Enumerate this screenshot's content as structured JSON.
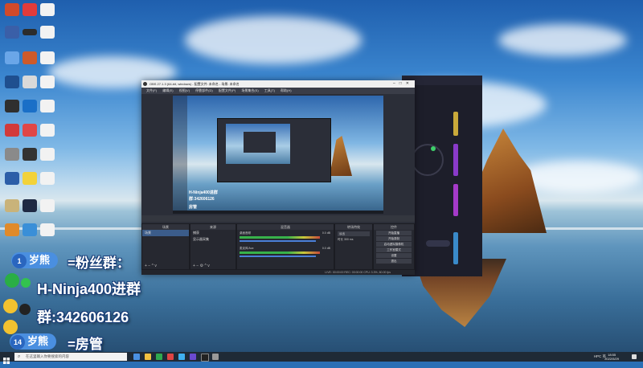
{
  "obs": {
    "title": "OBS 27.1.3 (64-bit, windows) - 配置文件: 未命名 - 场景: 未命名",
    "menu": [
      "文件(F)",
      "编辑(E)",
      "视图(V)",
      "停靠部件(D)",
      "配置文件(P)",
      "场景集合(S)",
      "工具(T)",
      "帮助(H)"
    ],
    "preview_labels": [
      "H-Ninja400进群",
      "群:342606126",
      "房管"
    ],
    "panels": {
      "scenes": "场景",
      "sources": "来源",
      "mixer": "混音器",
      "transitions": "转场特效",
      "controls": "控件"
    },
    "scenes_list": [
      "场景"
    ],
    "sources_list": [
      "捕获",
      "显示器采集"
    ],
    "mixer": {
      "tracks": [
        "桌面音频",
        "麦克风/Aux"
      ],
      "levels": [
        "0.0 dB",
        "0.0 dB"
      ]
    },
    "transition": {
      "type": "淡出",
      "duration_label": "时长",
      "duration": "300 ms"
    },
    "controls": [
      "开始直播",
      "开始录制",
      "启动虚拟摄像机",
      "工作室模式",
      "设置",
      "退出"
    ],
    "status": "LIVE: 00:00:00   REC: 00:00:00   CPU: 3.3%, 60.00 fps"
  },
  "overlay": {
    "badge1_level": "1",
    "badge1_name": "岁熊",
    "line1_suffix": "=粉丝群：",
    "line2": "H-Ninja400进群",
    "line3": "群:342606126",
    "badge2_level": "14",
    "badge2_name": "岁熊",
    "line4_suffix": "=房管"
  },
  "taskbar": {
    "search_placeholder": "在这里输入你要搜索的内容",
    "tray_text": "HPC 英",
    "time": "18:55",
    "date": "2022/5/29"
  },
  "icons": [
    "windows-start-icon",
    "search-icon",
    "wechat-icon",
    "qq-icon",
    "obs-icon",
    "chrome-icon"
  ],
  "colors": {
    "accent": "#4a8fe0",
    "obs_bg": "#2b2e38",
    "taskbar": "#1f2a36"
  }
}
